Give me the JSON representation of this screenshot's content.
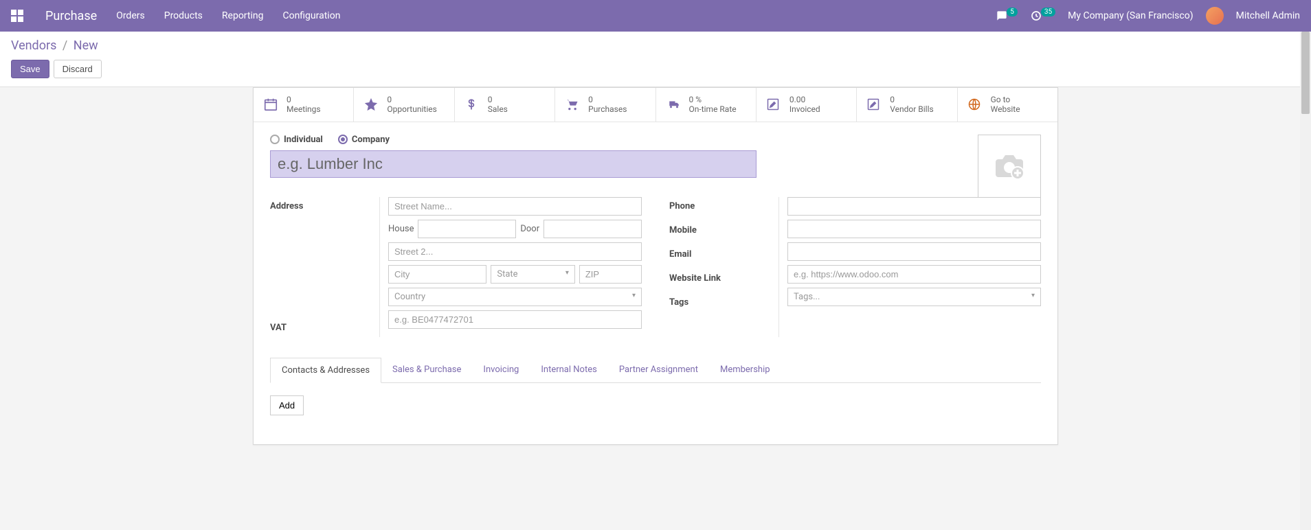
{
  "navbar": {
    "app_title": "Purchase",
    "menu": [
      "Orders",
      "Products",
      "Reporting",
      "Configuration"
    ],
    "msg_count": "5",
    "activity_count": "35",
    "company": "My Company (San Francisco)",
    "user": "Mitchell Admin"
  },
  "breadcrumb": {
    "parent": "Vendors",
    "current": "New"
  },
  "buttons": {
    "save": "Save",
    "discard": "Discard",
    "add": "Add"
  },
  "stats": [
    {
      "icon": "calendar",
      "value": "0",
      "label": "Meetings"
    },
    {
      "icon": "star",
      "value": "0",
      "label": "Opportunities"
    },
    {
      "icon": "dollar",
      "value": "0",
      "label": "Sales"
    },
    {
      "icon": "cart",
      "value": "0",
      "label": "Purchases"
    },
    {
      "icon": "truck",
      "value": "0 %",
      "label": "On-time Rate"
    },
    {
      "icon": "pencil",
      "value": "0.00",
      "label": "Invoiced"
    },
    {
      "icon": "pencil",
      "value": "0",
      "label": "Vendor Bills"
    },
    {
      "icon": "globe",
      "value": "Go to",
      "label": "Website"
    }
  ],
  "type": {
    "individual": "Individual",
    "company": "Company",
    "selected": "company"
  },
  "name_placeholder": "e.g. Lumber Inc",
  "left_labels": {
    "address": "Address",
    "house": "House",
    "door": "Door",
    "vat": "VAT"
  },
  "placeholders": {
    "street": "Street Name...",
    "street2": "Street 2...",
    "city": "City",
    "state": "State",
    "zip": "ZIP",
    "country": "Country",
    "vat": "e.g. BE0477472701",
    "website": "e.g. https://www.odoo.com",
    "tags": "Tags..."
  },
  "right_labels": {
    "phone": "Phone",
    "mobile": "Mobile",
    "email": "Email",
    "website": "Website Link",
    "tags": "Tags"
  },
  "tabs": [
    "Contacts & Addresses",
    "Sales & Purchase",
    "Invoicing",
    "Internal Notes",
    "Partner Assignment",
    "Membership"
  ]
}
